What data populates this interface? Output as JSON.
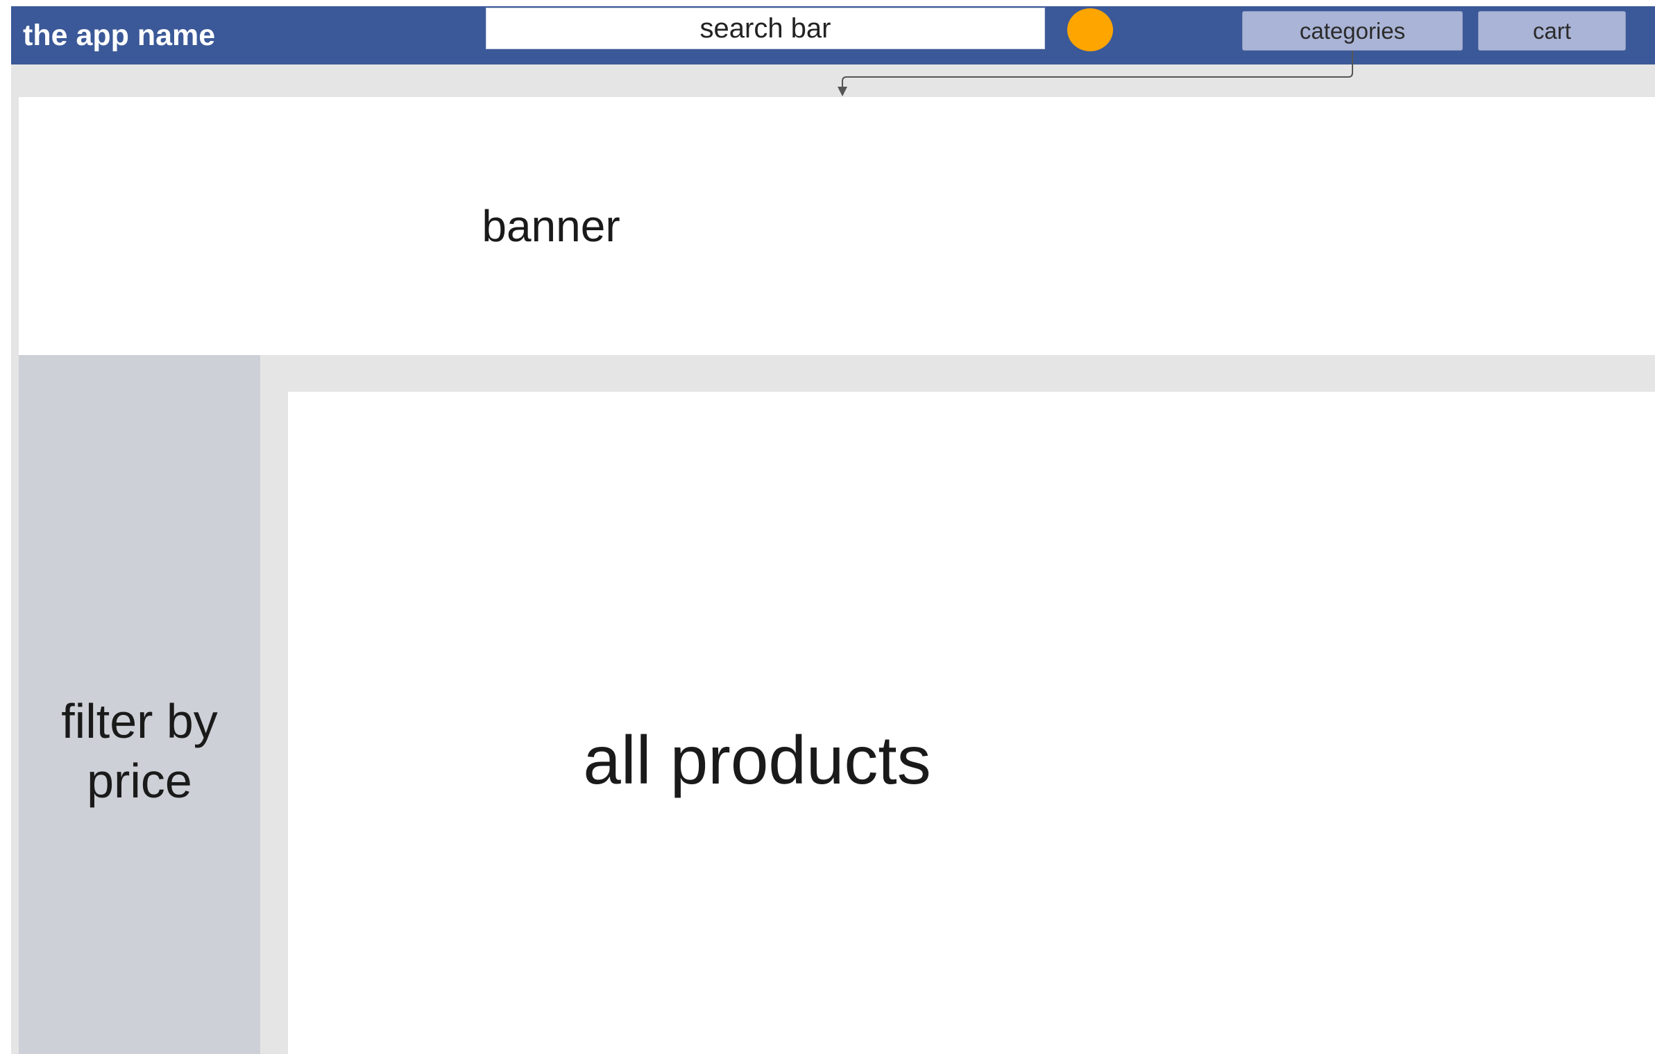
{
  "header": {
    "app_name": "the app name",
    "search": {
      "placeholder": "search bar"
    },
    "avatar_color": "#FFA500",
    "nav": {
      "categories_label": "categories",
      "cart_label": "cart"
    },
    "bar_color": "#3B5998"
  },
  "banner": {
    "label": "banner"
  },
  "sidebar": {
    "label": "filter by\nprice"
  },
  "main": {
    "label": "all products"
  }
}
